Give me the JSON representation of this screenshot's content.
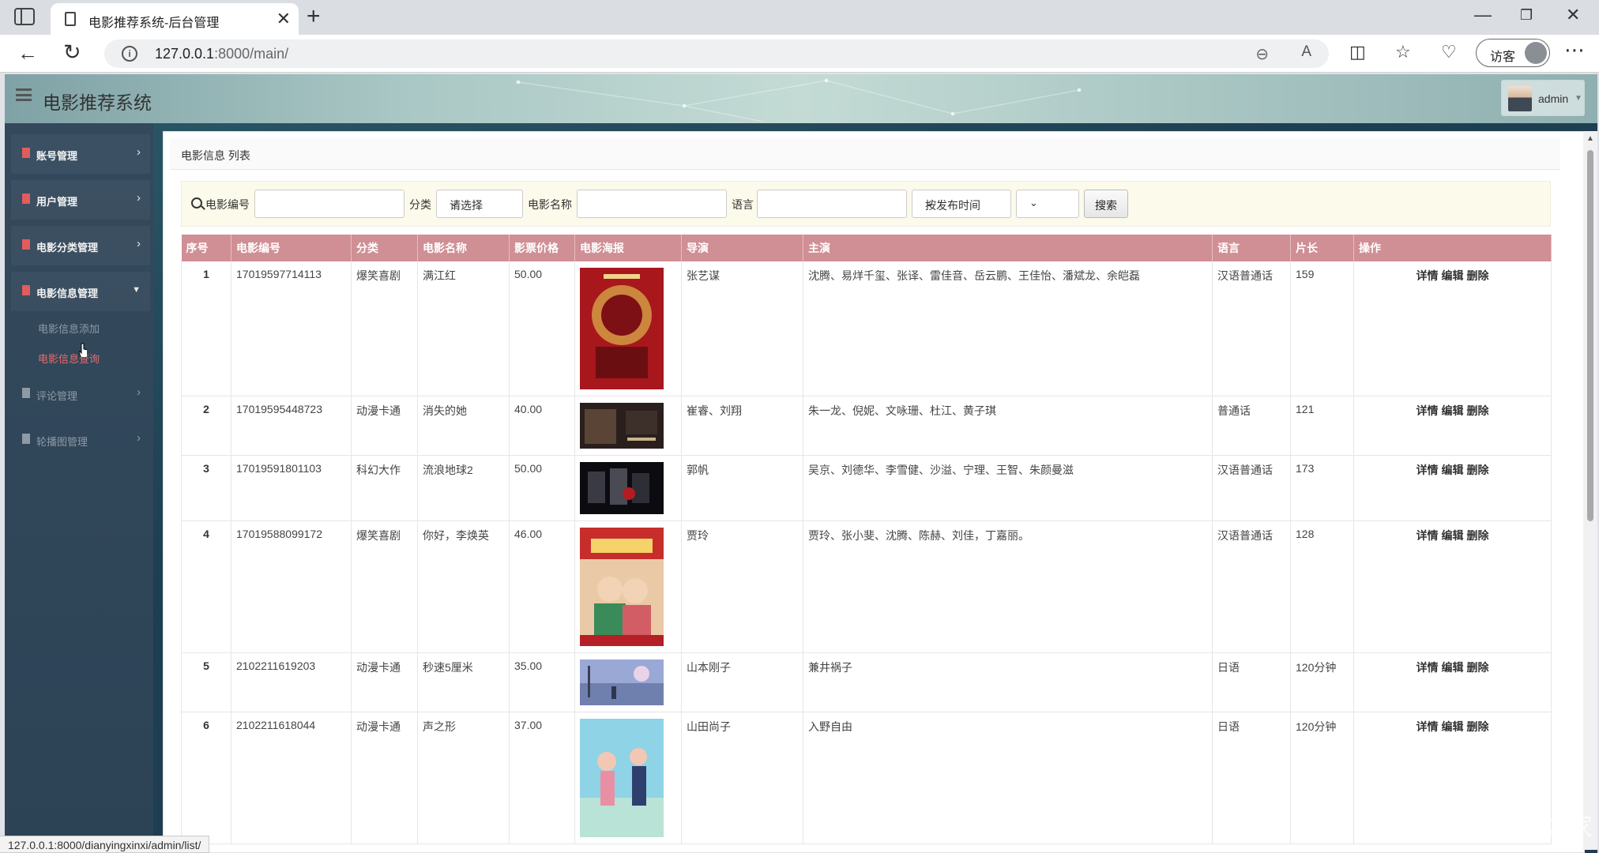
{
  "browser": {
    "tab_title": "电影推荐系统-后台管理",
    "url_host": "127.0.0.1",
    "url_rest": ":8000/main/",
    "profile_label": "访客",
    "status_url": "127.0.0.1:8000/dianyingxinxi/admin/list/"
  },
  "header": {
    "title": "电影推荐系统",
    "username": "admin"
  },
  "sidebar": {
    "items": [
      {
        "label": "账号管理"
      },
      {
        "label": "用户管理"
      },
      {
        "label": "电影分类管理"
      },
      {
        "label": "电影信息管理"
      },
      {
        "label": "评论管理"
      },
      {
        "label": "轮播图管理"
      }
    ],
    "subitems": [
      {
        "label": "电影信息添加"
      },
      {
        "label": "电影信息查询"
      }
    ]
  },
  "main": {
    "breadcrumb": "电影信息 列表",
    "search": {
      "label_id": "电影编号",
      "label_category": "分类",
      "category_value": "请选择",
      "label_name": "电影名称",
      "label_language": "语言",
      "sort_value": "按发布时间",
      "order_value": "",
      "button_label": "搜索"
    },
    "table": {
      "headers": [
        "序号",
        "电影编号",
        "分类",
        "电影名称",
        "影票价格",
        "电影海报",
        "导演",
        "主演",
        "语言",
        "片长",
        "操作"
      ],
      "actions": [
        "详情",
        "编辑",
        "删除"
      ],
      "rows": [
        {
          "no": "1",
          "id": "17019597714113",
          "category": "爆笑喜剧",
          "name": "满江红",
          "price": "50.00",
          "director": "张艺谋",
          "cast": "沈腾、易烊千玺、张译、雷佳音、岳云鹏、王佳怡、潘斌龙、余皑磊",
          "language": "汉语普通话",
          "duration": "159"
        },
        {
          "no": "2",
          "id": "17019595448723",
          "category": "动漫卡通",
          "name": "消失的她",
          "price": "40.00",
          "director": "崔睿、刘翔",
          "cast": "朱一龙、倪妮、文咏珊、杜江、黄子琪",
          "language": "普通话",
          "duration": "121"
        },
        {
          "no": "3",
          "id": "17019591801103",
          "category": "科幻大作",
          "name": "流浪地球2",
          "price": "50.00",
          "director": "郭帆",
          "cast": "吴京、刘德华、李雪健、沙溢、宁理、王智、朱颜曼滋",
          "language": "汉语普通话",
          "duration": "173"
        },
        {
          "no": "4",
          "id": "17019588099172",
          "category": "爆笑喜剧",
          "name": "你好，李焕英",
          "price": "46.00",
          "director": "贾玲",
          "cast": "贾玲、张小斐、沈腾、陈赫、刘佳，丁嘉丽。",
          "language": "汉语普通话",
          "duration": "128"
        },
        {
          "no": "5",
          "id": "2102211619203",
          "category": "动漫卡通",
          "name": "秒速5厘米",
          "price": "35.00",
          "director": "山本刚子",
          "cast": "兼井祸子",
          "language": "日语",
          "duration": "120分钟"
        },
        {
          "no": "6",
          "id": "2102211618044",
          "category": "动漫卡通",
          "name": "声之形",
          "price": "37.00",
          "director": "山田尚子",
          "cast": "入野自由",
          "language": "日语",
          "duration": "120分钟"
        }
      ]
    }
  },
  "watermark": "CSDN @源码之家",
  "colors": {
    "table_header": "#cf8f94",
    "sidebar_bg": "#34495c",
    "active_sub": "#e86b6b",
    "search_bg": "#fbfaeb"
  }
}
